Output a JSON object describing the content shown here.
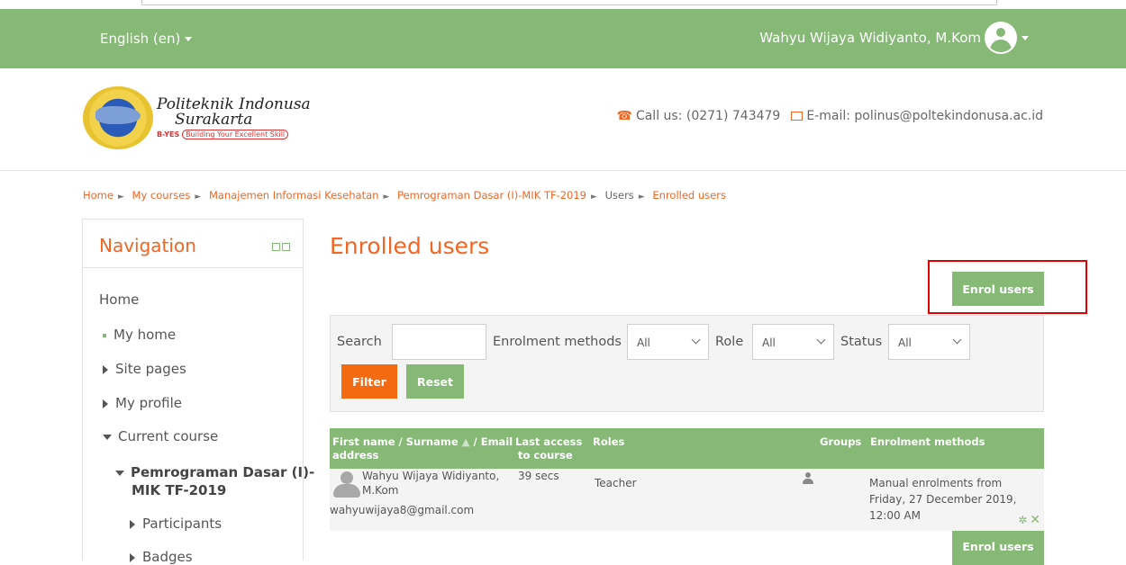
{
  "topbar": {
    "language": "English (en)",
    "user_name": "Wahyu Wijaya Widiyanto, M.Kom"
  },
  "header": {
    "logo_line1": "Politeknik Indonusa",
    "logo_line2": "Surakarta",
    "logo_tag": "B-YES",
    "logo_tag_box": "Building Your Excellent Skill",
    "phone": "Call us: (0271) 743479",
    "email": "E-mail: polinus@poltekindonusa.ac.id"
  },
  "breadcrumb": {
    "items": [
      "Home",
      "My courses",
      "Manajemen Informasi Kesehatan",
      "Pemrograman Dasar (I)-MIK TF-2019",
      "Users",
      "Enrolled users"
    ]
  },
  "navigation": {
    "title": "Navigation",
    "items": [
      "Home",
      "My home",
      "Site pages",
      "My profile",
      "Current course",
      "Pemrograman Dasar (I)-",
      "MIK TF-2019",
      "Participants",
      "Badges"
    ]
  },
  "main": {
    "title": "Enrolled users",
    "enrol_button": "Enrol users",
    "filters": {
      "search_label": "Search",
      "search_value": "",
      "enrolment_label": "Enrolment methods",
      "enrolment_value": "All",
      "role_label": "Role",
      "role_value": "All",
      "status_label": "Status",
      "status_value": "All",
      "filter_button": "Filter",
      "reset_button": "Reset"
    },
    "table": {
      "headers": {
        "name_a": "First name / Surname",
        "name_b": "/ Email",
        "name_c": "address",
        "access_a": "Last access",
        "access_b": "to course",
        "roles": "Roles",
        "groups": "Groups",
        "methods": "Enrolment methods"
      },
      "rows": [
        {
          "name_a": "Wahyu Wijaya Widiyanto,",
          "name_b": "M.Kom",
          "email": "wahyuwijaya8@gmail.com",
          "last_access": "39 secs",
          "role": "Teacher",
          "method_a": "Manual enrolments from",
          "method_b": "Friday, 27 December 2019,",
          "method_c": "12:00 AM"
        }
      ]
    },
    "enrol_button_bottom": "Enrol users"
  },
  "colors": {
    "brand_green": "#86b876",
    "accent_orange": "#f26522",
    "highlight_red": "#e00000"
  }
}
